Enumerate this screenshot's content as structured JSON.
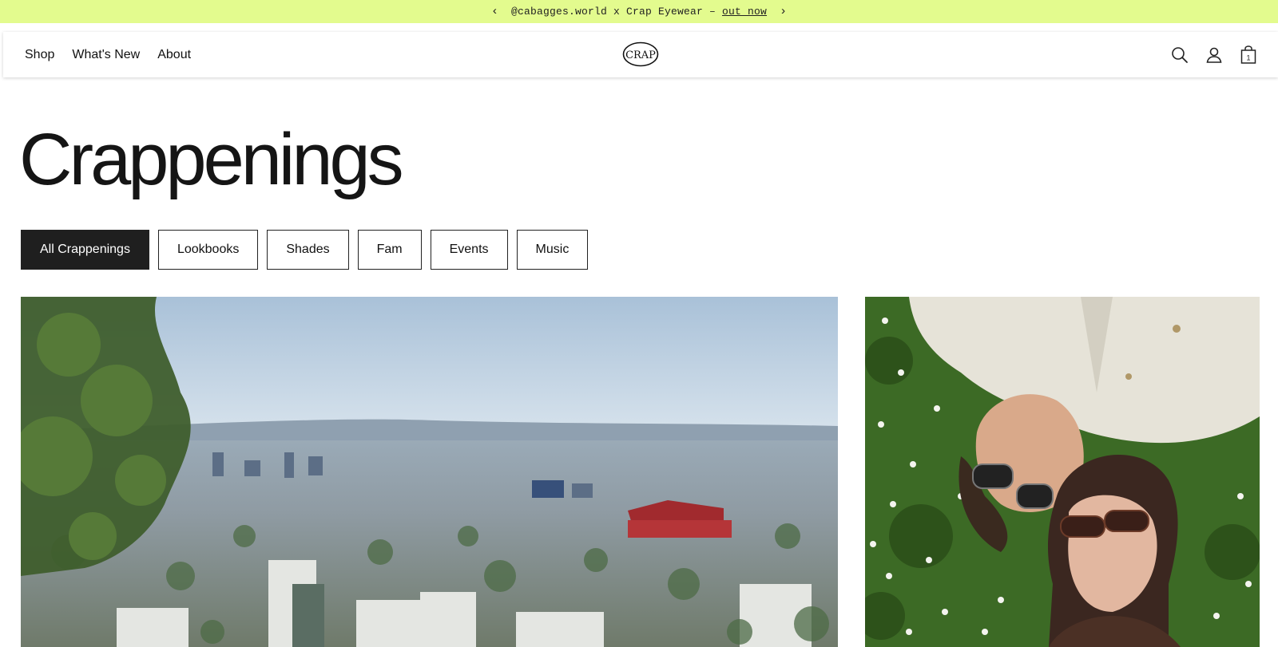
{
  "announcement": {
    "prev": "‹",
    "text": "@cabagges.world x Crap Eyewear – ",
    "link": "out now",
    "next": "›"
  },
  "nav": {
    "items": [
      {
        "label": "Shop"
      },
      {
        "label": "What's New"
      },
      {
        "label": "About"
      }
    ],
    "logo_text": "CRAP",
    "icons": [
      "search-icon",
      "account-icon",
      "cart-icon"
    ],
    "cart_count": "1"
  },
  "page": {
    "title": "Crappenings"
  },
  "filters": [
    {
      "label": "All Crappenings",
      "active": true
    },
    {
      "label": "Lookbooks",
      "active": false
    },
    {
      "label": "Shades",
      "active": false
    },
    {
      "label": "Fam",
      "active": false
    },
    {
      "label": "Events",
      "active": false
    },
    {
      "label": "Music",
      "active": false
    }
  ],
  "colors": {
    "announcement_bg": "#e3fb8e",
    "active_filter_bg": "#1f1f1f",
    "text": "#111111"
  }
}
